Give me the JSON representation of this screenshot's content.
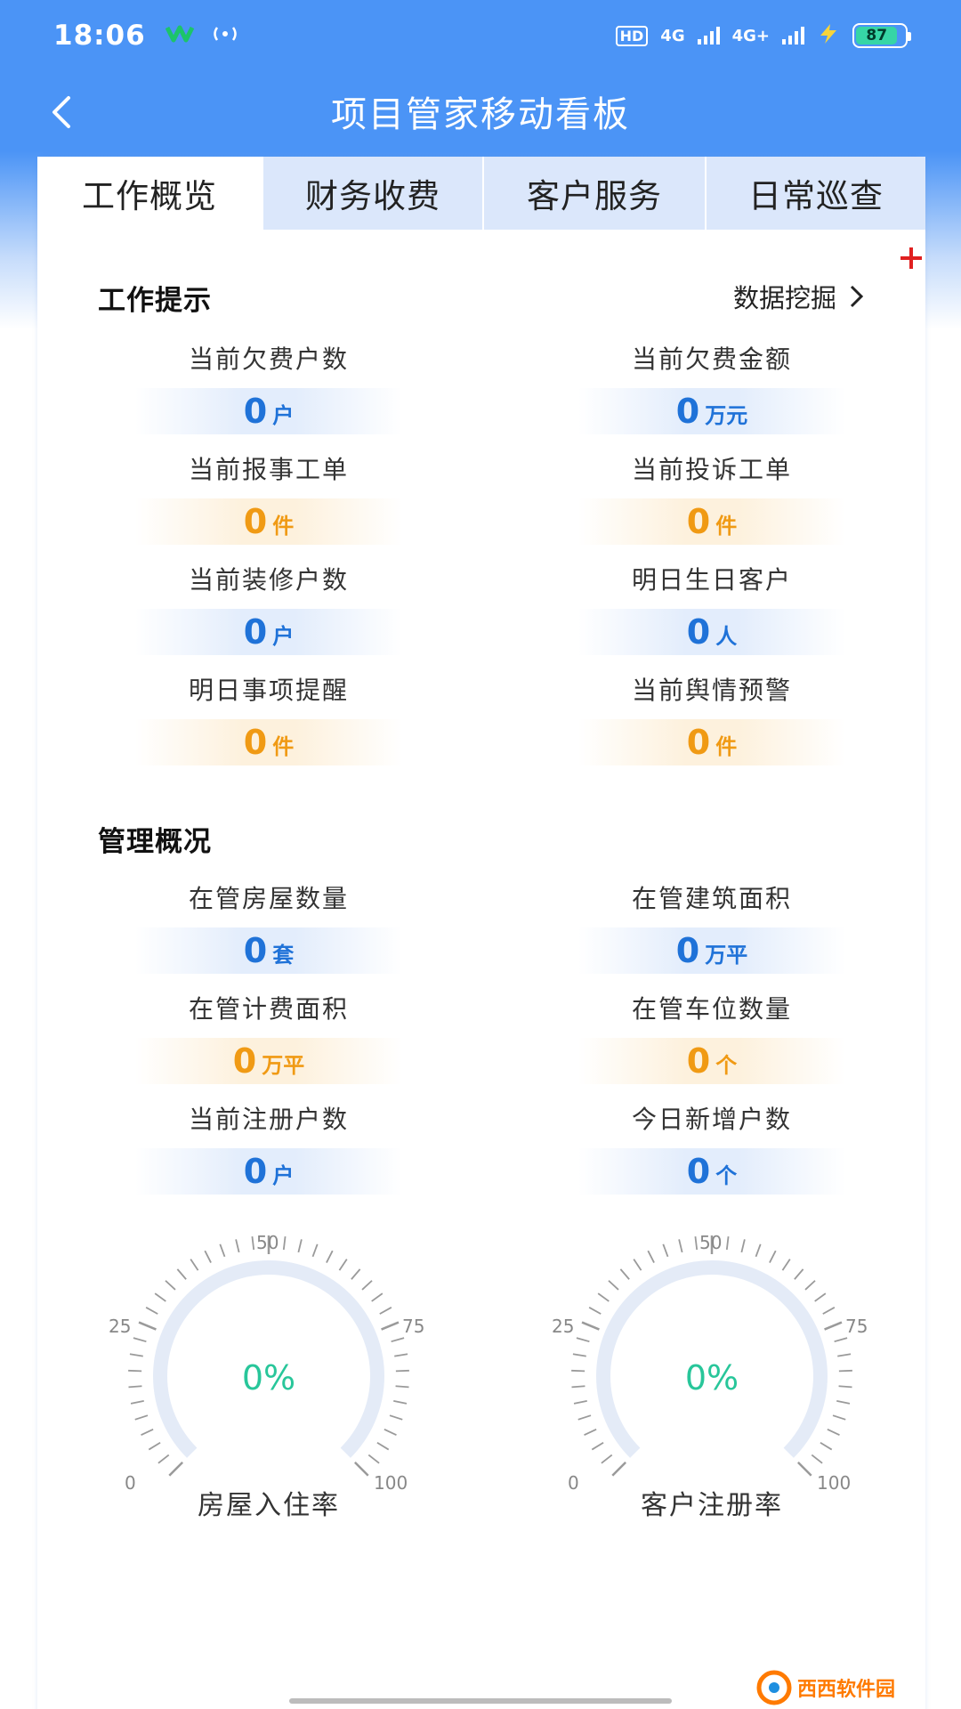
{
  "status_bar": {
    "time": "18:06",
    "hd_label": "HD",
    "net1": "4G",
    "net2": "4G+",
    "battery": "87"
  },
  "nav": {
    "title": "项目管家移动看板"
  },
  "tabs": [
    {
      "label": "工作概览"
    },
    {
      "label": "财务收费"
    },
    {
      "label": "客户服务"
    },
    {
      "label": "日常巡查"
    }
  ],
  "work_tips": {
    "title": "工作提示",
    "link": "数据挖掘",
    "items": [
      {
        "label": "当前欠费户数",
        "value": "0",
        "unit": "户"
      },
      {
        "label": "当前欠费金额",
        "value": "0",
        "unit": "万元"
      },
      {
        "label": "当前报事工单",
        "value": "0",
        "unit": "件"
      },
      {
        "label": "当前投诉工单",
        "value": "0",
        "unit": "件"
      },
      {
        "label": "当前装修户数",
        "value": "0",
        "unit": "户"
      },
      {
        "label": "明日生日客户",
        "value": "0",
        "unit": "人"
      },
      {
        "label": "明日事项提醒",
        "value": "0",
        "unit": "件"
      },
      {
        "label": "当前舆情预警",
        "value": "0",
        "unit": "件"
      }
    ]
  },
  "management": {
    "title": "管理概况",
    "items": [
      {
        "label": "在管房屋数量",
        "value": "0",
        "unit": "套"
      },
      {
        "label": "在管建筑面积",
        "value": "0",
        "unit": "万平"
      },
      {
        "label": "在管计费面积",
        "value": "0",
        "unit": "万平"
      },
      {
        "label": "在管车位数量",
        "value": "0",
        "unit": "个"
      },
      {
        "label": "当前注册户数",
        "value": "0",
        "unit": "户"
      },
      {
        "label": "今日新增户数",
        "value": "0",
        "unit": "个"
      }
    ]
  },
  "gauges": [
    {
      "label": "房屋入住率",
      "value": "0%",
      "ticks": [
        "0",
        "25",
        "50",
        "75",
        "100"
      ]
    },
    {
      "label": "客户注册率",
      "value": "0%",
      "ticks": [
        "0",
        "25",
        "50",
        "75",
        "100"
      ]
    }
  ],
  "watermark": {
    "text": "西西软件园"
  },
  "colors": {
    "header_blue": "#4b94f6",
    "value_blue": "#1f72d8",
    "value_orange": "#f09a14",
    "gauge_green": "#28c69a",
    "plus_red": "#e02020"
  }
}
